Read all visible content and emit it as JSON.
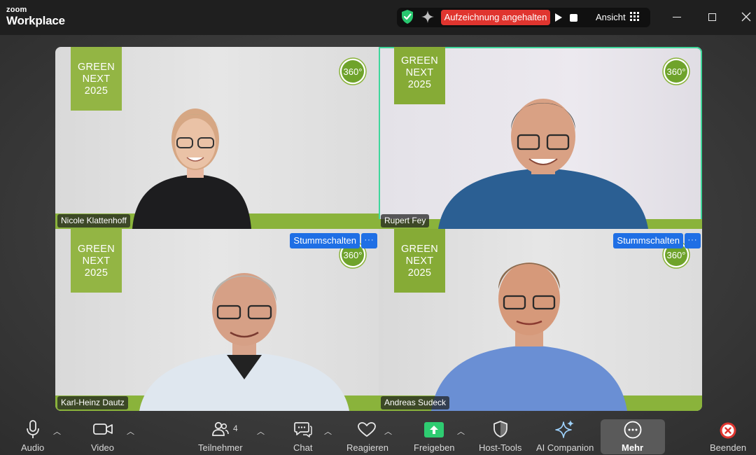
{
  "app": {
    "brand_small": "zoom",
    "brand_name": "Workplace"
  },
  "topbar": {
    "recording_status": "Aufzeichnung angehalten",
    "view_label": "Ansicht",
    "colors": {
      "recording": "#e0352f",
      "shield": "#28c76f"
    }
  },
  "tiles": [
    {
      "name": "Nicole Klattenhoff",
      "banner": [
        "GREEN",
        "NEXT",
        "2025"
      ],
      "logo": "360°",
      "active": false
    },
    {
      "name": "Rupert Fey",
      "banner": [
        "GREEN",
        "NEXT",
        "2025"
      ],
      "logo": "360°",
      "active": true
    },
    {
      "name": "Karl-Heinz Dautz",
      "banner": [
        "GREEN",
        "NEXT",
        "2025"
      ],
      "logo": "360°",
      "mute_label": "Stummschalten",
      "more_label": "···"
    },
    {
      "name": "Andreas Sudeck",
      "banner": [
        "GREEN",
        "NEXT",
        "2025"
      ],
      "logo": "360°",
      "mute_label": "Stummschalten",
      "more_label": "···"
    }
  ],
  "toolbar": {
    "audio": "Audio",
    "video": "Video",
    "participants": "Teilnehmer",
    "participants_count": "4",
    "chat": "Chat",
    "react": "Reagieren",
    "share": "Freigeben",
    "host_tools": "Host-Tools",
    "ai_companion": "AI Companion",
    "more": "Mehr",
    "end": "Beenden",
    "colors": {
      "share": "#2ecc71",
      "end": "#e0352f"
    }
  }
}
